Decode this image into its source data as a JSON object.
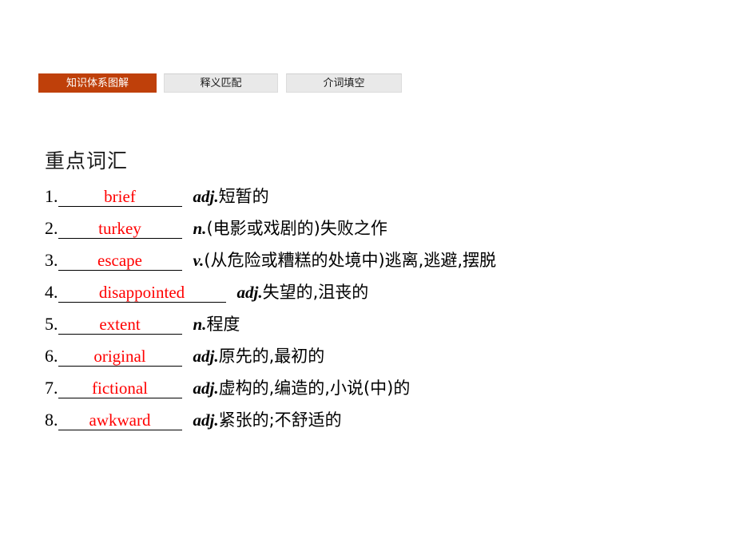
{
  "tabs": [
    {
      "label": "知识体系图解",
      "active": true
    },
    {
      "label": "释义匹配",
      "active": false
    },
    {
      "label": "介词填空",
      "active": false
    }
  ],
  "section": {
    "title": "重点词汇"
  },
  "colors": {
    "active_tab_background": "#bf400a",
    "active_tab_text": "#ffffff",
    "inactive_tab_background": "#e9e9e9",
    "answer_text": "#ff0000",
    "page_background": "#ffffff"
  },
  "vocabulary": [
    {
      "num": "1.",
      "answer": "brief",
      "pos": "adj.",
      "meaning": "短暂的",
      "wide": false
    },
    {
      "num": "2.",
      "answer": "turkey",
      "pos": "n.",
      "meaning": "(电影或戏剧的)失败之作",
      "wide": false
    },
    {
      "num": "3.",
      "answer": "escape",
      "pos": "v.",
      "meaning": "(从危险或糟糕的处境中)逃离,逃避,摆脱",
      "wide": false
    },
    {
      "num": "4.",
      "answer": "disappointed",
      "pos": "adj.",
      "meaning": "失望的,沮丧的",
      "wide": true
    },
    {
      "num": "5.",
      "answer": "extent",
      "pos": "n.",
      "meaning": "程度",
      "wide": false
    },
    {
      "num": "6.",
      "answer": "original",
      "pos": "adj.",
      "meaning": "原先的,最初的",
      "wide": false
    },
    {
      "num": "7.",
      "answer": "fictional",
      "pos": "adj.",
      "meaning": "虚构的,编造的,小说(中)的",
      "wide": false
    },
    {
      "num": "8.",
      "answer": "awkward",
      "pos": "adj.",
      "meaning": "紧张的;不舒适的",
      "wide": false
    }
  ]
}
